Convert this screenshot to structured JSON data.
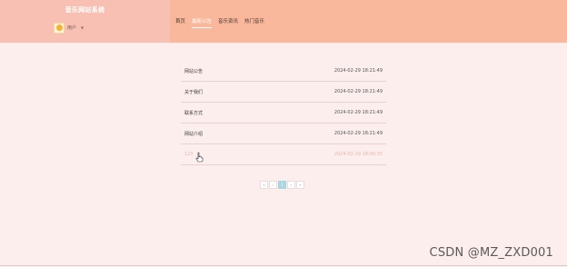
{
  "site": {
    "title": "音乐网站系统",
    "user_name": "用户",
    "caret": "▼"
  },
  "nav": {
    "items": [
      {
        "label": "首页",
        "active": false
      },
      {
        "label": "最新公告",
        "active": true
      },
      {
        "label": "音乐资讯",
        "active": false
      },
      {
        "label": "热门音乐",
        "active": false
      }
    ]
  },
  "announcements": [
    {
      "title": "网站公告",
      "date": "2024-02-29 18:21:49"
    },
    {
      "title": "关于我们",
      "date": "2024-02-29 18:21:49"
    },
    {
      "title": "联系方式",
      "date": "2024-02-29 18:21:49"
    },
    {
      "title": "网站介绍",
      "date": "2024-02-29 18:21:49"
    },
    {
      "title": "123",
      "date": "2024-02-29 18:00:35"
    }
  ],
  "pagination": {
    "first": "«",
    "prev": "‹",
    "current": "1",
    "next": "›",
    "last": "»"
  },
  "watermark": "CSDN @MZ_ZXD001",
  "colors": {
    "page_bg": "#fdeeee",
    "sidebar_header": "#f7c0b2",
    "topbar": "#f9b89b",
    "active_page": "#a9d6e0"
  }
}
